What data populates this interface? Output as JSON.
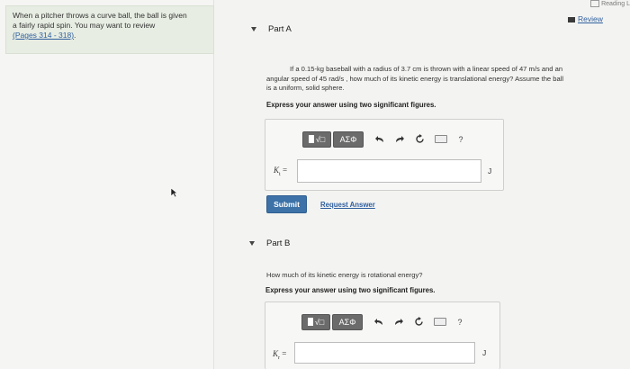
{
  "sidebar": {
    "intro_line1": "When a pitcher throws a curve ball, the ball is given",
    "intro_line2": "a fairly rapid spin. You may want to review",
    "pages_link": "(Pages 314 - 318)",
    "pages_suffix": "."
  },
  "header": {
    "top_right_label": "Reading L",
    "review_label": "Review"
  },
  "part_a": {
    "title": "Part A",
    "question_line1": "If a 0.15-kg baseball with a radius of 3.7 cm is thrown with a linear speed of 47 m/s and an",
    "question_line2": "angular speed of 45 rad/s , how much of its kinetic energy is translational energy? Assume the ball",
    "question_line3": "is a uniform, solid sphere.",
    "instruction": "Express your answer using two significant figures.",
    "var_symbol": "K",
    "var_sub": "t",
    "equals": "=",
    "unit": "J",
    "input_value": ""
  },
  "toolbar": {
    "template_label": "√□",
    "symbols_label": "ΑΣΦ",
    "help_label": "?"
  },
  "actions": {
    "submit_label": "Submit",
    "request_answer_label": "Request Answer"
  },
  "part_b": {
    "title": "Part B",
    "question": "How much of its kinetic energy is rotational energy?",
    "instruction": "Express your answer using two significant figures.",
    "var_symbol": "K",
    "var_sub": "r",
    "equals": "=",
    "unit": "J",
    "input_value": ""
  }
}
